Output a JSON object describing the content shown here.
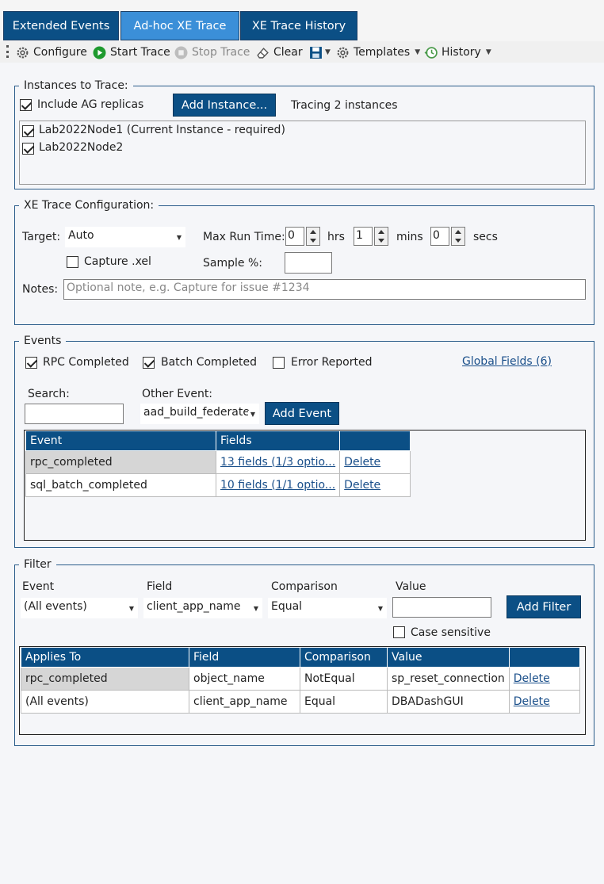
{
  "tabs": [
    {
      "label": "Extended Events",
      "active": false
    },
    {
      "label": "Ad-hoc XE Trace",
      "active": true
    },
    {
      "label": "XE Trace History",
      "active": false
    }
  ],
  "toolbar": {
    "configure": "Configure",
    "start_trace": "Start Trace",
    "stop_trace": "Stop Trace",
    "clear": "Clear",
    "templates": "Templates",
    "history": "History"
  },
  "instances": {
    "legend": "Instances to Trace:",
    "include_ag_label": "Include AG replicas",
    "include_ag_checked": true,
    "add_instance_button": "Add Instance...",
    "tracing_status": "Tracing 2 instances",
    "items": [
      {
        "label": "Lab2022Node1 (Current Instance - required)",
        "checked": true
      },
      {
        "label": "Lab2022Node2",
        "checked": true
      }
    ]
  },
  "config": {
    "legend": "XE Trace Configuration:",
    "target_label": "Target:",
    "target_value": "Auto",
    "max_run_time_label": "Max Run Time:",
    "hrs_value": "0",
    "hrs_label": "hrs",
    "mins_value": "1",
    "mins_label": "mins",
    "secs_value": "0",
    "secs_label": "secs",
    "capture_xel_label": "Capture .xel",
    "capture_xel_checked": false,
    "sample_label": "Sample %:",
    "sample_value": "",
    "notes_label": "Notes:",
    "notes_placeholder": "Optional note, e.g. Capture for issue #1234"
  },
  "events": {
    "legend": "Events",
    "rpc_completed_label": "RPC Completed",
    "rpc_completed_checked": true,
    "batch_completed_label": "Batch Completed",
    "batch_completed_checked": true,
    "error_reported_label": "Error Reported",
    "error_reported_checked": false,
    "global_fields_link": "Global Fields (6)",
    "search_label": "Search:",
    "search_value": "",
    "other_event_label": "Other Event:",
    "other_event_value": "aad_build_federate",
    "add_event_button": "Add Event",
    "grid": {
      "headers": [
        "Event",
        "Fields",
        ""
      ],
      "rows": [
        {
          "event": "rpc_completed",
          "fields": "13 fields (1/3 optio...",
          "action": "Delete"
        },
        {
          "event": "sql_batch_completed",
          "fields": "10 fields (1/1 optio...",
          "action": "Delete"
        }
      ]
    }
  },
  "filter": {
    "legend": "Filter",
    "event_label": "Event",
    "event_value": "(All events)",
    "field_label": "Field",
    "field_value": "client_app_name",
    "comparison_label": "Comparison",
    "comparison_value": "Equal",
    "value_label": "Value",
    "value_value": "",
    "add_filter_button": "Add Filter",
    "case_sensitive_label": "Case sensitive",
    "case_sensitive_checked": false,
    "grid": {
      "headers": [
        "Applies To",
        "Field",
        "Comparison",
        "Value",
        ""
      ],
      "rows": [
        {
          "applies_to": "rpc_completed",
          "field": "object_name",
          "comparison": "NotEqual",
          "value": "sp_reset_connection",
          "action": "Delete"
        },
        {
          "applies_to": "(All events)",
          "field": "client_app_name",
          "comparison": "Equal",
          "value": "DBADashGUI",
          "action": "Delete"
        }
      ]
    }
  },
  "colors": {
    "tab_bg": "#0b4f85",
    "tab_active_bg": "#3b8fd8",
    "header_bg": "#0b4f85",
    "group_border": "#2a5c8a",
    "link": "#1a4f8a",
    "selected_cell": "#d6d6d6"
  }
}
